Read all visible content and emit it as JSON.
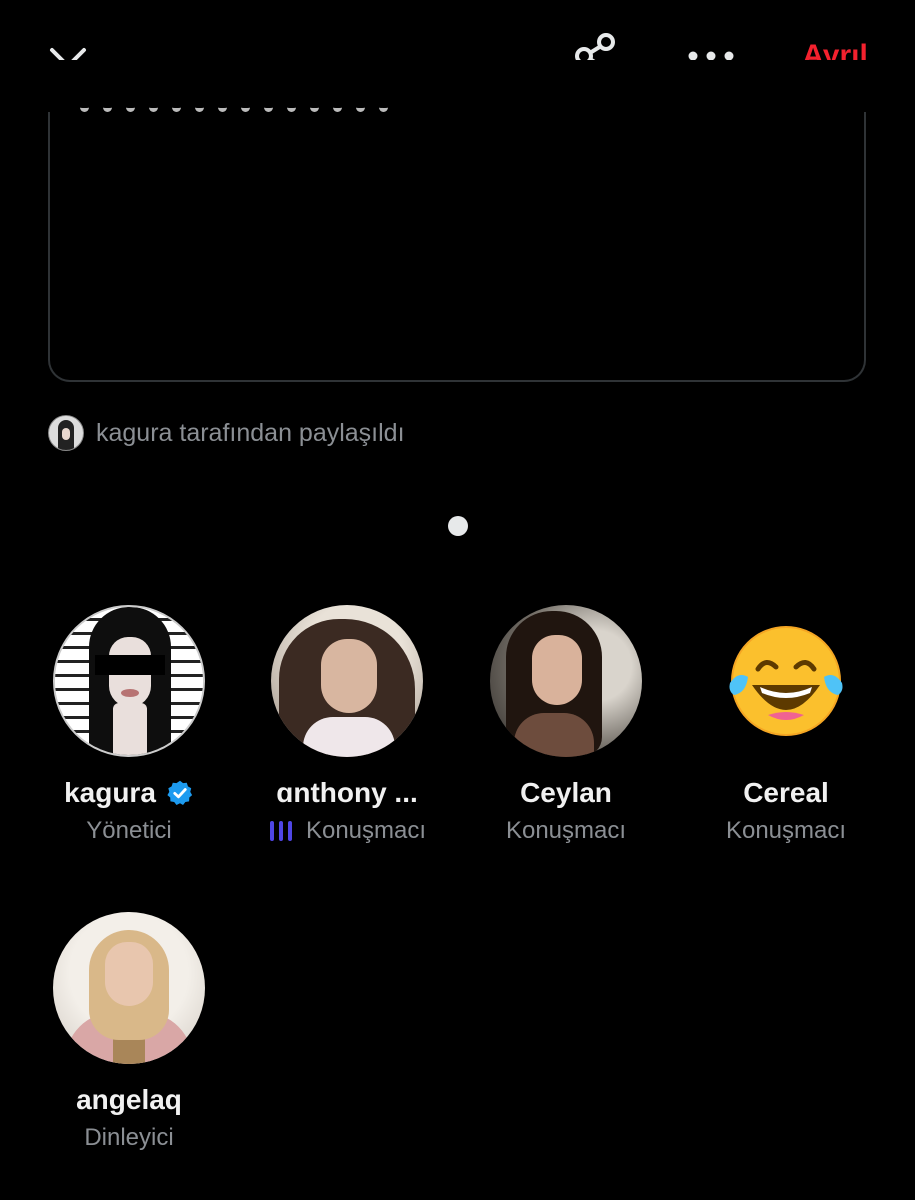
{
  "header": {
    "collapse_icon": "chevron-down-icon",
    "share_icon": "share-icon",
    "more_icon": "more-horizontal-icon",
    "leave_label": "Ayrıl"
  },
  "shared_by": {
    "text": "kagura tarafından paylaşıldı"
  },
  "participants": [
    {
      "name": "kagura",
      "role": "Yönetici",
      "verified": true,
      "speaking": false
    },
    {
      "name": "ɑnthony ...",
      "role": "Konuşmacı",
      "verified": false,
      "speaking": true
    },
    {
      "name": "Ceylan",
      "role": "Konuşmacı",
      "verified": false,
      "speaking": false
    },
    {
      "name": "Cereal",
      "role": "Konuşmacı",
      "verified": false,
      "speaking": false,
      "avatar_emoji": "😂"
    },
    {
      "name": "angelaq",
      "role": "Dinleyici",
      "verified": false,
      "speaking": false
    }
  ],
  "colors": {
    "background": "#000000",
    "leave": "#f4212e",
    "verified": "#1d9bf0",
    "speaking": "#4f46e5",
    "secondary_text": "#8b8f94"
  }
}
